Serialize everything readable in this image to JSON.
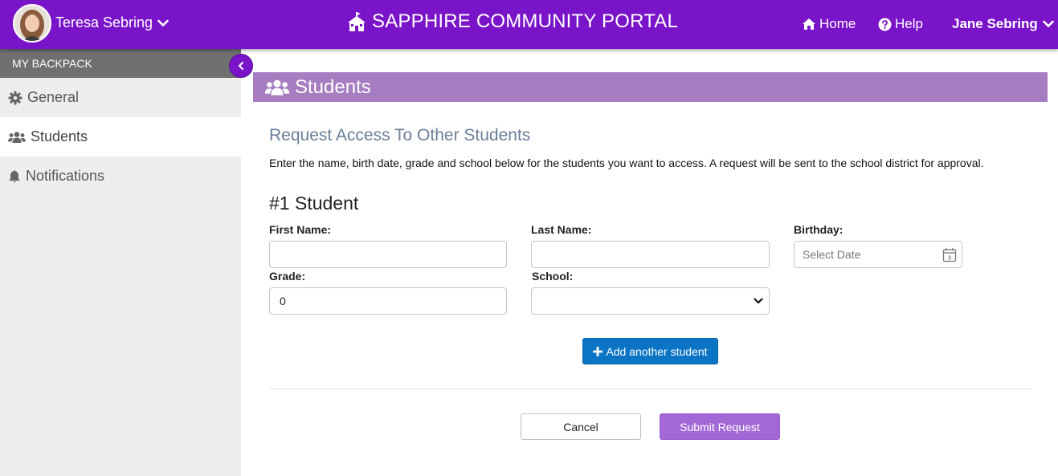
{
  "topbar": {
    "user_name": "Teresa Sebring",
    "brand_title": "SAPPHIRE COMMUNITY PORTAL",
    "nav_home": "Home",
    "nav_help": "Help",
    "account_name": "Jane Sebring"
  },
  "sidebar": {
    "section_label": "MY BACKPACK",
    "items": [
      {
        "label": "General",
        "icon": "gear-icon",
        "active": false
      },
      {
        "label": "Students",
        "icon": "users-icon",
        "active": true
      },
      {
        "label": "Notifications",
        "icon": "bell-icon",
        "active": false
      }
    ]
  },
  "main": {
    "section_title": "Students",
    "request_title": "Request Access To Other Students",
    "request_description": "Enter the name, birth date, grade and school below for the students you want to access. A request will be sent to the school district for approval.",
    "student_heading": "#1 Student",
    "form": {
      "first_name_label": "First Name:",
      "first_name_value": "",
      "last_name_label": "Last Name:",
      "last_name_value": "",
      "birthday_label": "Birthday:",
      "birthday_placeholder": "Select Date",
      "birthday_calendar_day": "3",
      "grade_label": "Grade:",
      "grade_value": "0",
      "school_label": "School:",
      "school_value": ""
    },
    "add_student_label": "Add another student",
    "cancel_label": "Cancel",
    "submit_label": "Submit Request"
  },
  "colors": {
    "topbar": "#7a14c9",
    "section_header": "#a57dc0",
    "primary_button": "#0b74c4",
    "submit_button": "#a368d6"
  }
}
